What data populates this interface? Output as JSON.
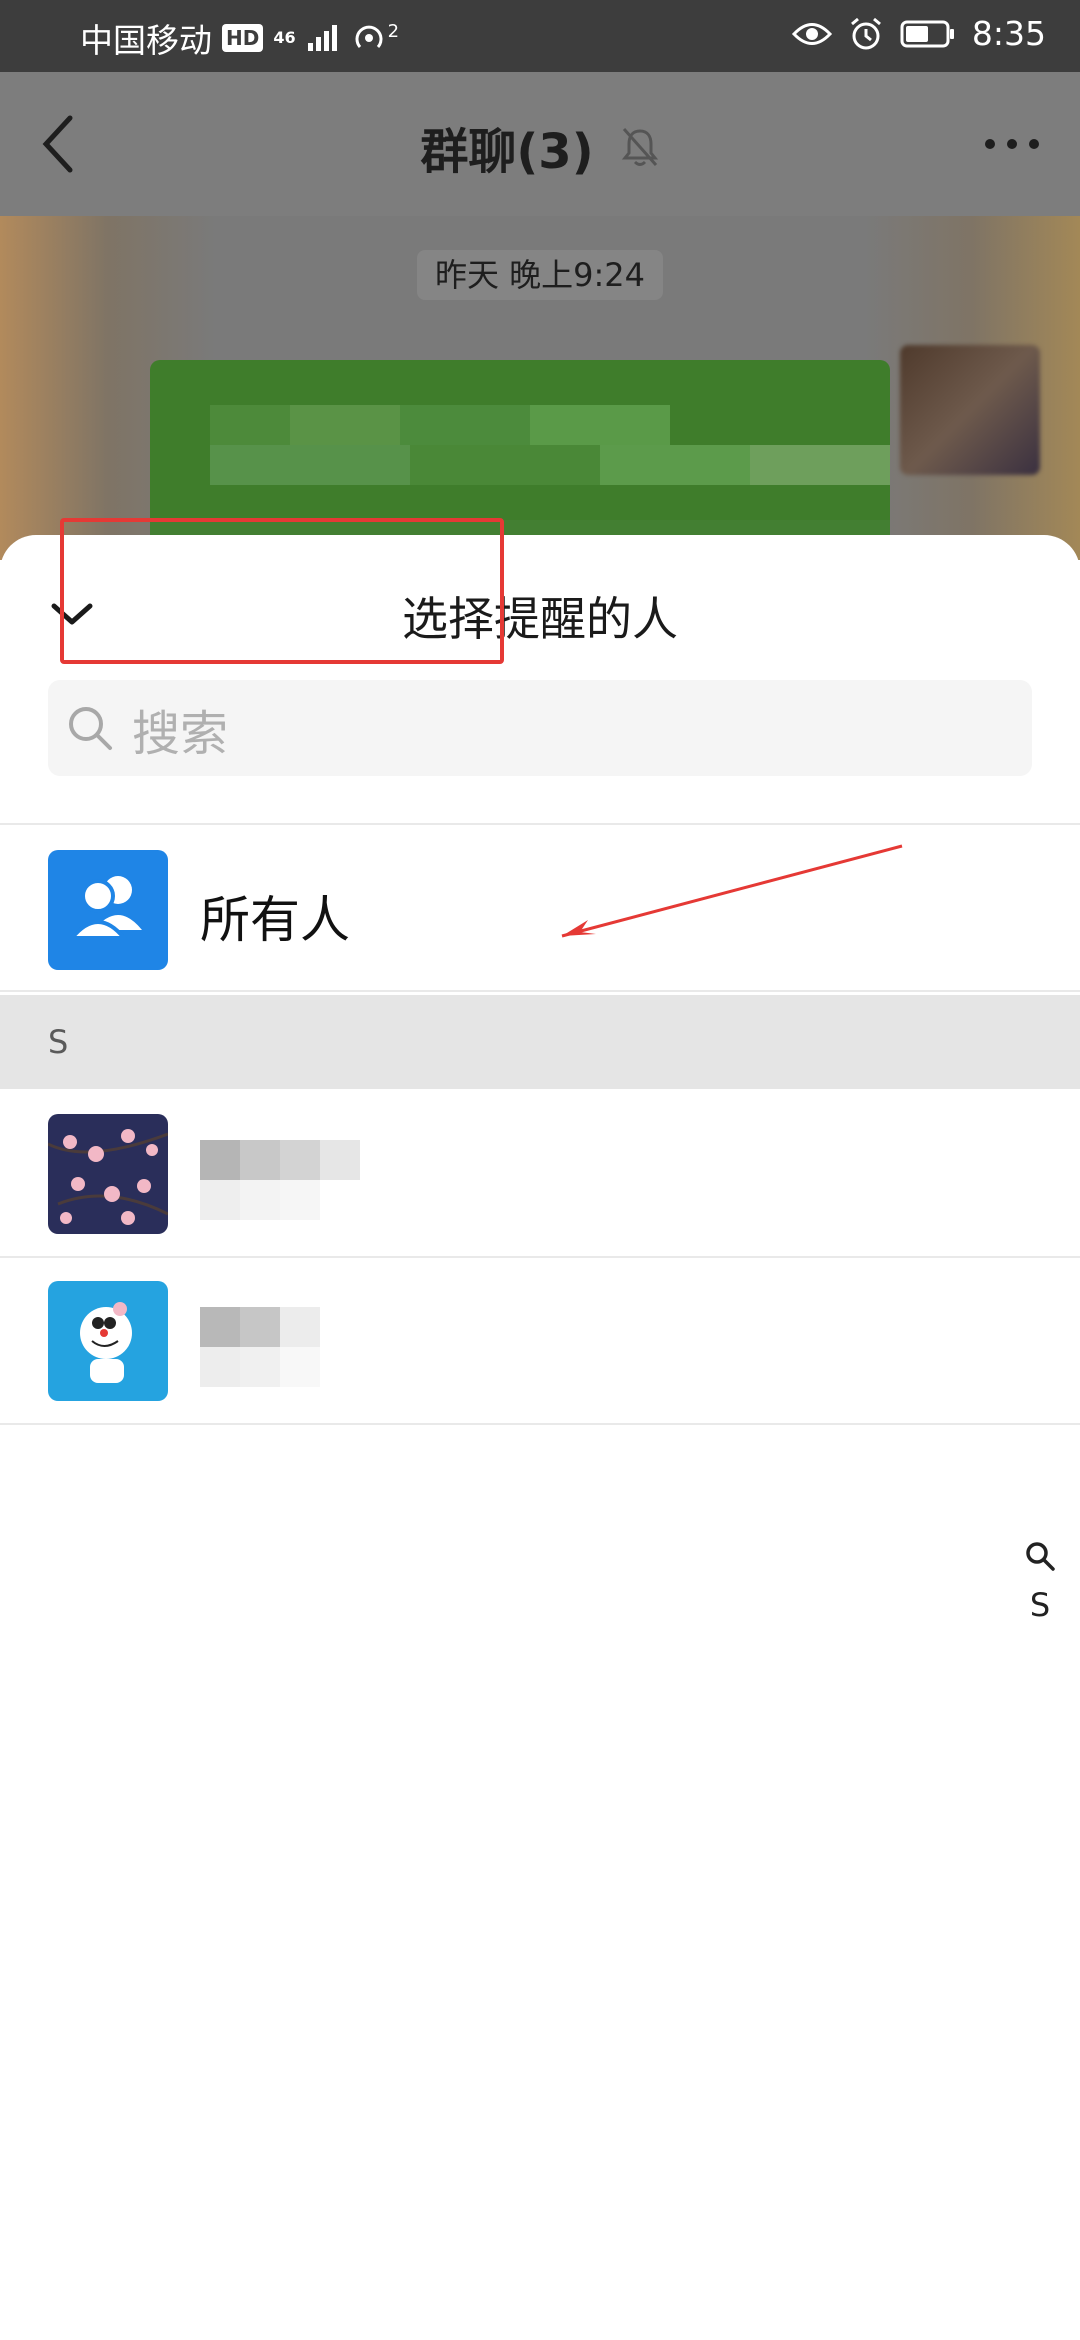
{
  "status_bar": {
    "carrier": "中国移动",
    "hd_badge": "HD",
    "signal": "46",
    "hotspot_count": "2",
    "time": "8:35"
  },
  "chat_nav": {
    "title": "群聊(3)"
  },
  "chat": {
    "timestamp": "昨天 晚上9:24"
  },
  "sheet": {
    "title": "选择提醒的人",
    "search_placeholder": "搜索",
    "everyone_label": "所有人",
    "section_letter": "S",
    "index_letter": "S"
  },
  "colors": {
    "accent_blue": "#1f85e6",
    "annotation_red": "#e53935",
    "section_bg": "#e5e5e5"
  }
}
